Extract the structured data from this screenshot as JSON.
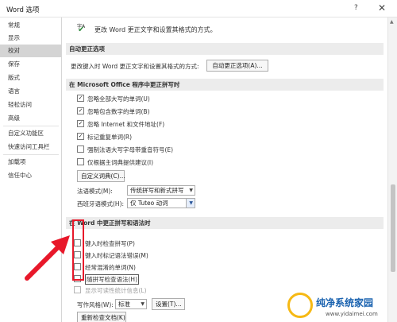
{
  "window": {
    "title": "Word 选项",
    "help": "?",
    "close": "✕"
  },
  "sidebar": {
    "items": [
      {
        "label": "常规"
      },
      {
        "label": "显示"
      },
      {
        "label": "校对",
        "active": true
      },
      {
        "label": "保存"
      },
      {
        "label": "版式"
      },
      {
        "label": "语言"
      },
      {
        "label": "轻松访问"
      },
      {
        "label": "高级"
      },
      {
        "label": "自定义功能区"
      },
      {
        "label": "快速访问工具栏"
      },
      {
        "label": "加载项"
      },
      {
        "label": "信任中心"
      }
    ]
  },
  "header": {
    "icon_letters": "字A",
    "description": "更改 Word 更正文字和设置其格式的方式。"
  },
  "autocorrect": {
    "section_title": "自动更正选项",
    "row_label": "更改键入时 Word 更正文字和设置其格式的方式:",
    "button": "自动更正选项(A)..."
  },
  "office_spelling": {
    "section_title": "在 Microsoft Office 程序中更正拼写时",
    "checkboxes": [
      {
        "label": "忽略全部大写的单词(U)",
        "checked": true
      },
      {
        "label": "忽略包含数字的单词(B)",
        "checked": true
      },
      {
        "label": "忽略 Internet 和文件地址(F)",
        "checked": true
      },
      {
        "label": "标记重复单词(R)",
        "checked": true
      },
      {
        "label": "强制法语大写字母带重音符号(E)",
        "checked": false
      },
      {
        "label": "仅根据主词典提供建议(I)",
        "checked": false
      }
    ],
    "custom_dict_button": "自定义词典(C)...",
    "french_mode_label": "法语模式(M):",
    "french_mode_value": "传统拼写和新式拼写",
    "spanish_mode_label": "西班牙语模式(H):",
    "spanish_mode_value": "仅 Tuteo 动词"
  },
  "word_spelling": {
    "section_title": "在 Word 中更正拼写和语法时",
    "checkboxes": [
      {
        "label": "键入时检查拼写(P)",
        "checked": false,
        "dim": false
      },
      {
        "label": "键入时标记语法错误(M)",
        "checked": false,
        "dim": false
      },
      {
        "label": "经常混淆的单词(N)",
        "checked": false,
        "dim": false
      },
      {
        "label": "随拼写检查语法(H)",
        "checked": false,
        "dim": false
      },
      {
        "label": "显示可读性统计信息(L)",
        "checked": false,
        "dim": true
      }
    ],
    "writing_style_label": "写作风格(W):",
    "writing_style_value": "标准",
    "settings_button": "设置(T)...",
    "recheck_button": "重新检查文档(K)"
  },
  "watermark": {
    "main": "纯净系统家园",
    "url": "www.yidaimei.com"
  },
  "colors": {
    "annotation_red": "#e8182a",
    "checkmark_green": "#2e8a3c",
    "watermark_blue": "#1b63b0",
    "watermark_yellow": "#f6b915"
  }
}
